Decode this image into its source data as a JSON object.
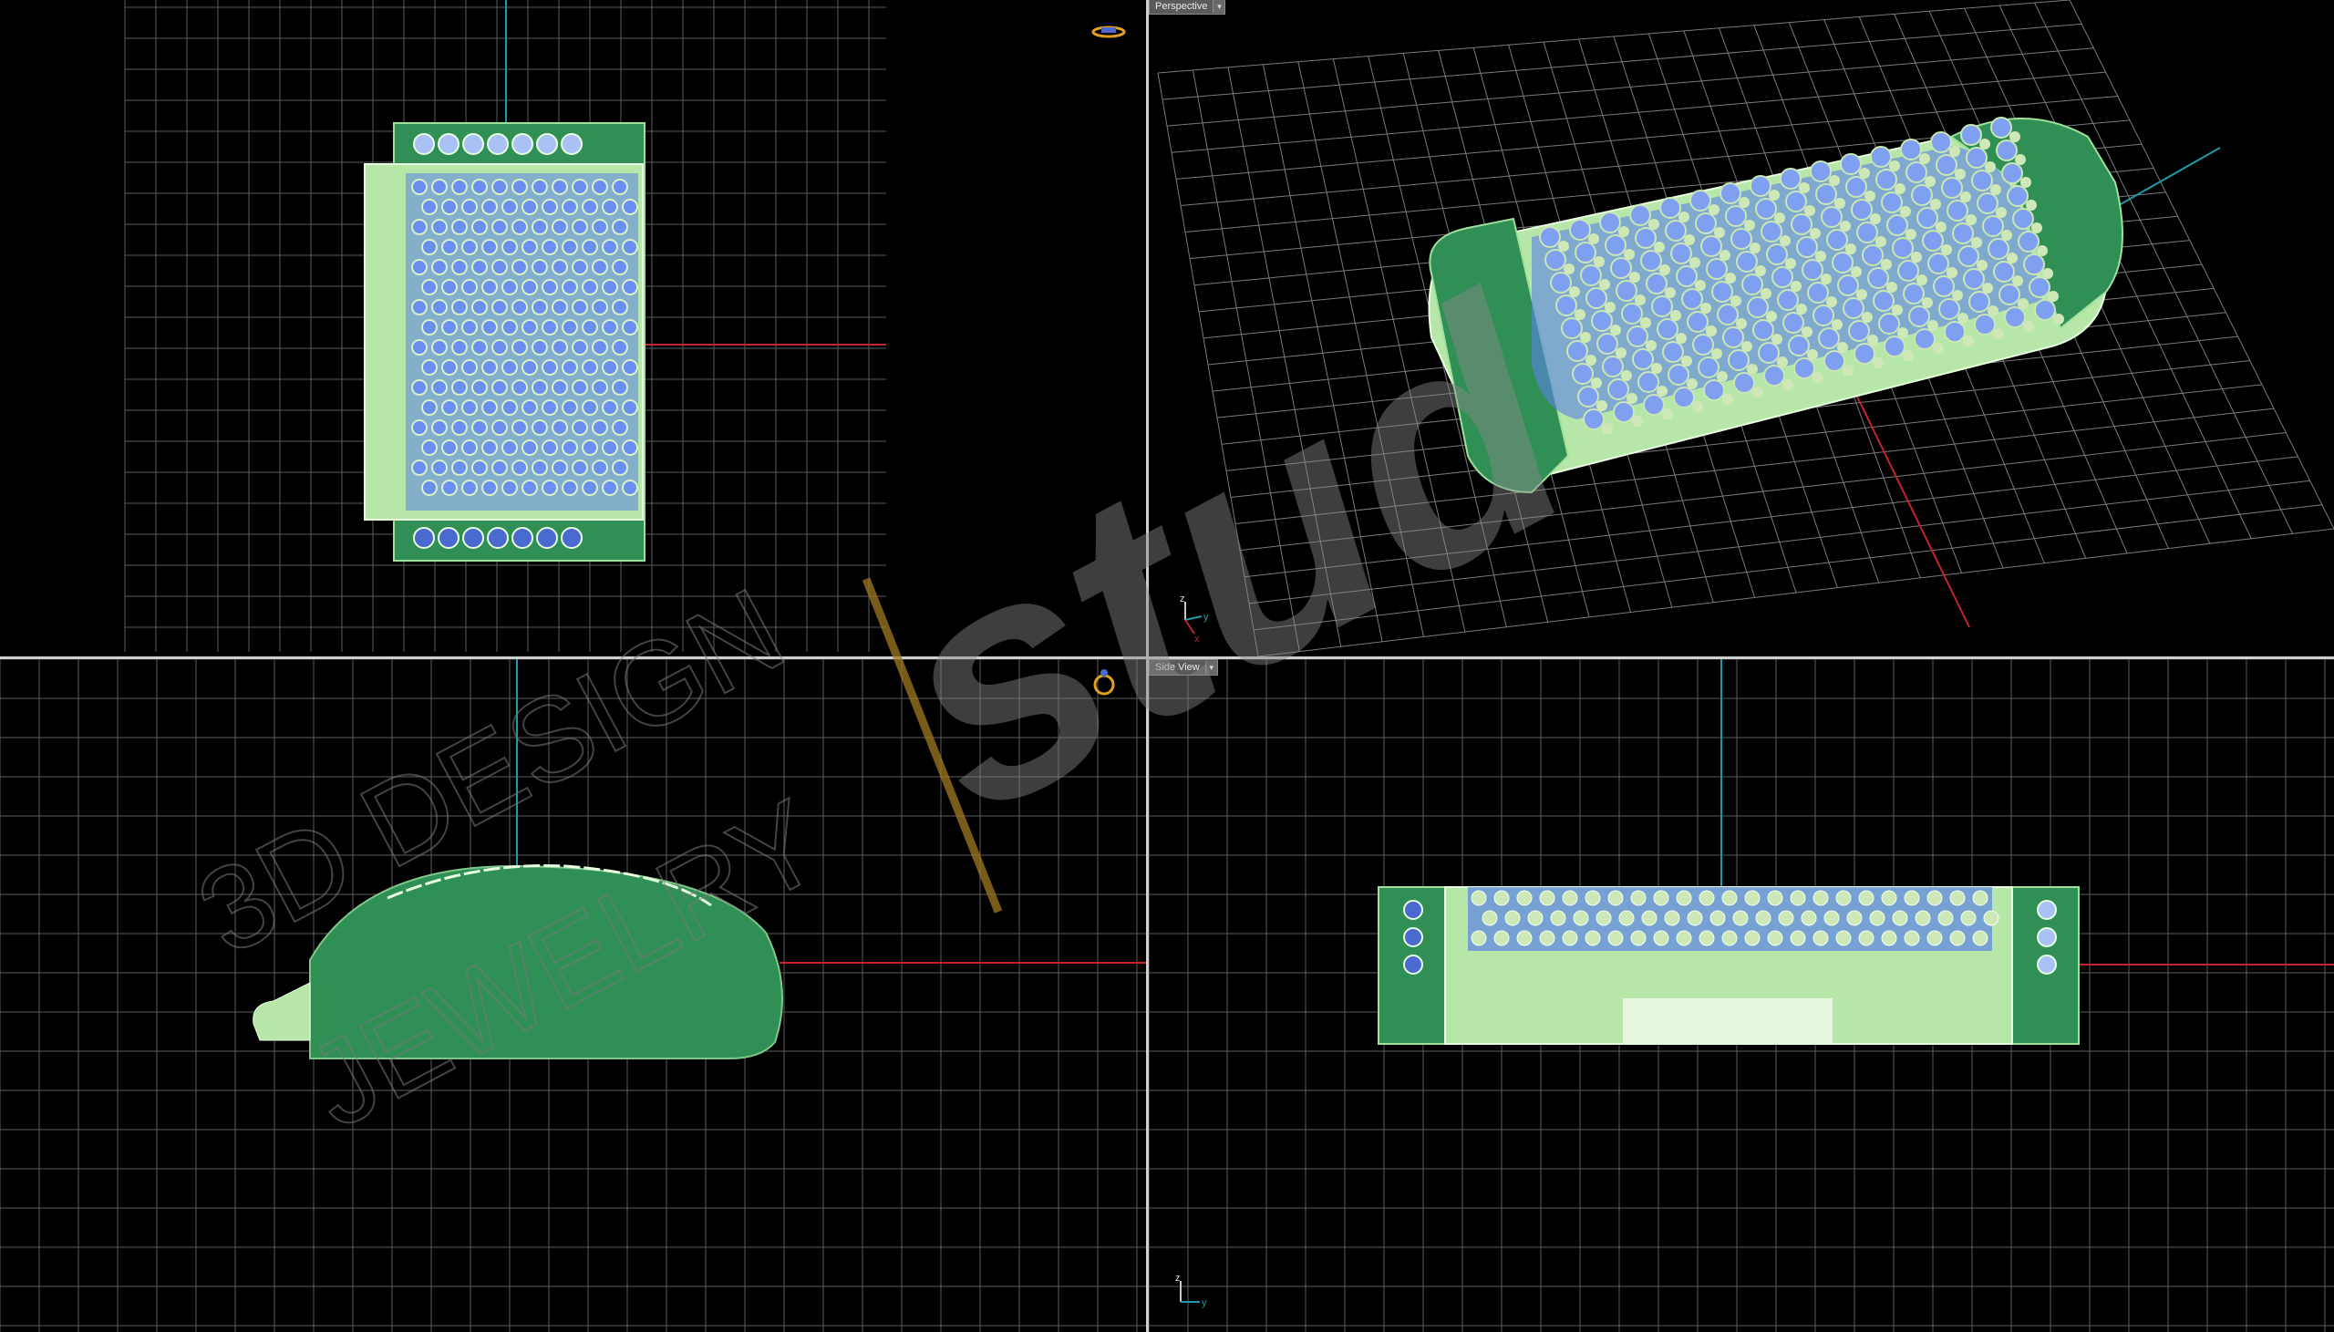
{
  "viewports": {
    "top": {
      "view_label": ""
    },
    "perspective": {
      "view_label": "Perspective",
      "menu_glyph": "▾"
    },
    "front": {
      "view_label": ""
    },
    "side": {
      "view_label": "Side View",
      "menu_glyph": "▾"
    }
  },
  "axis_gizmo": {
    "x": "x",
    "y": "y",
    "z": "z"
  },
  "watermark": {
    "line1": "3D DESIGN",
    "line2": "JEWELRY",
    "brand": "stud"
  },
  "colors": {
    "grid": "#5c5c5c",
    "grid_major": "#8a8a8a",
    "axis_x": "#c0262b",
    "axis_y": "#1f9aa8",
    "model_green": "#2f8f55",
    "model_light": "#b7e7a8",
    "gem_blue": "#5b82e6",
    "bead": "#cfe8b8"
  }
}
